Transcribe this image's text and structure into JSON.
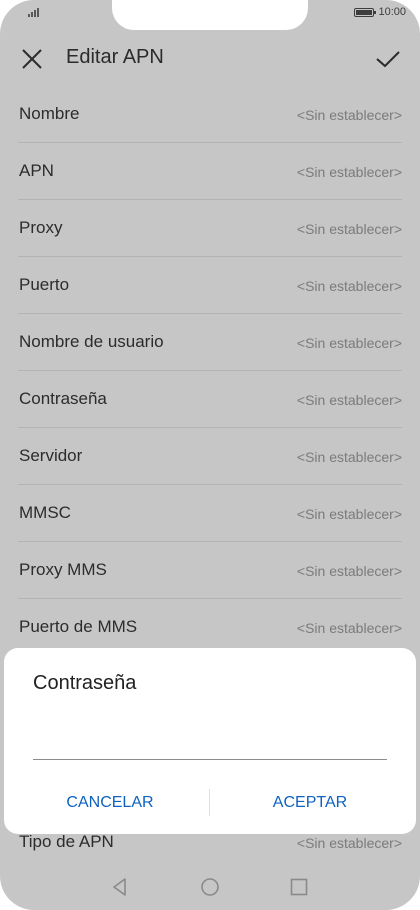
{
  "status_bar": {
    "time": "10:00"
  },
  "header": {
    "title": "Editar APN"
  },
  "apn_list": {
    "items": [
      {
        "label": "Nombre",
        "value": "<Sin establecer>"
      },
      {
        "label": "APN",
        "value": "<Sin establecer>"
      },
      {
        "label": "Proxy",
        "value": "<Sin establecer>"
      },
      {
        "label": "Puerto",
        "value": "<Sin establecer>"
      },
      {
        "label": "Nombre de usuario",
        "value": "<Sin establecer>"
      },
      {
        "label": "Contraseña",
        "value": "<Sin establecer>"
      },
      {
        "label": "Servidor",
        "value": "<Sin establecer>"
      },
      {
        "label": "MMSC",
        "value": "<Sin establecer>"
      },
      {
        "label": "Proxy MMS",
        "value": "<Sin establecer>"
      },
      {
        "label": "Puerto de MMS",
        "value": "<Sin establecer>"
      }
    ],
    "bottom_item": {
      "label": "Tipo de APN",
      "value": "<Sin establecer>"
    }
  },
  "dialog": {
    "title": "Contraseña",
    "input_value": "",
    "cancel_label": "CANCELAR",
    "accept_label": "ACEPTAR",
    "accent_color": "#0e62c0"
  },
  "colors": {
    "overlay_background": "#c6c6c6",
    "dialog_background": "#ffffff"
  },
  "icons": {
    "close": "close-icon",
    "confirm": "check-icon",
    "nav_back": "back-triangle-icon",
    "nav_home": "home-circle-icon",
    "nav_recent": "recent-square-icon"
  }
}
